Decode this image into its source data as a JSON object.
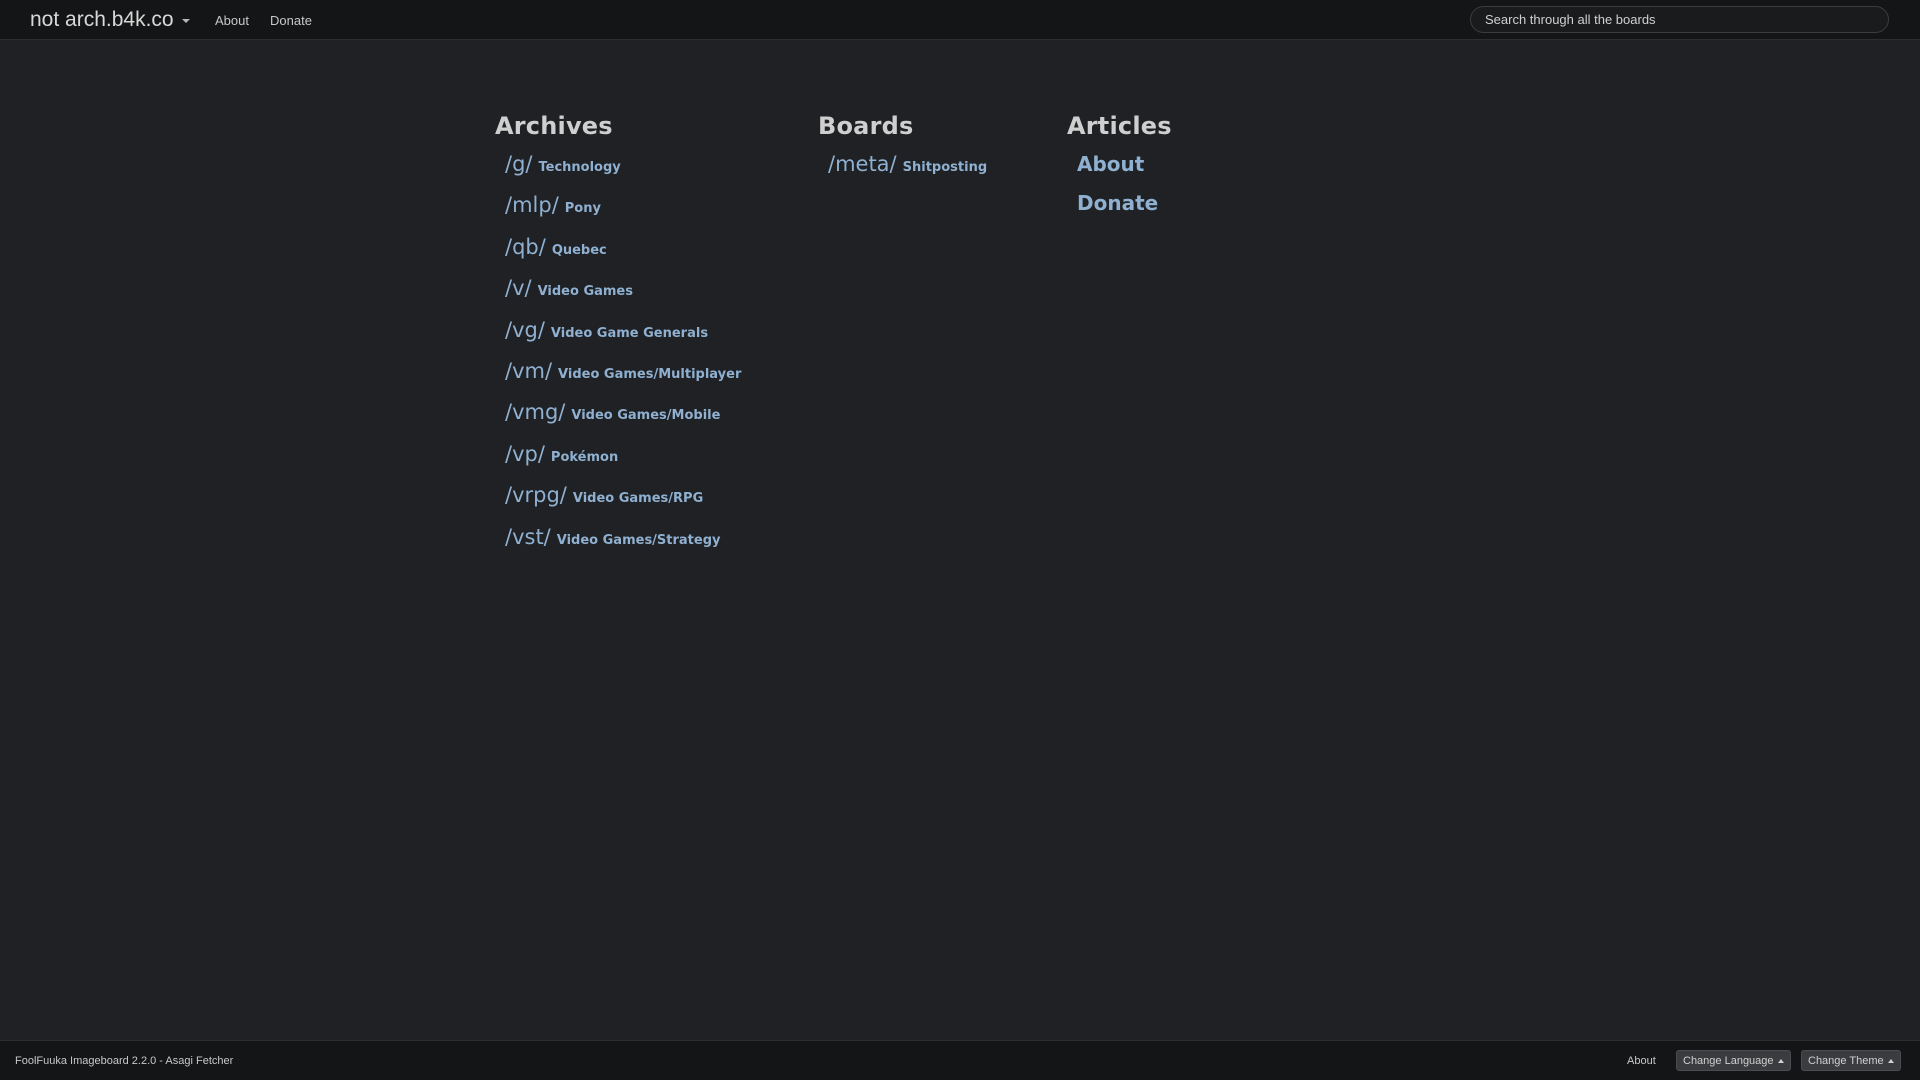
{
  "navbar": {
    "brand": "not arch.b4k.co",
    "links": [
      "About",
      "Donate"
    ],
    "search_placeholder": "Search through all the boards"
  },
  "archives": {
    "title": "Archives",
    "boards": [
      {
        "code": "/g/",
        "name": "Technology"
      },
      {
        "code": "/mlp/",
        "name": "Pony"
      },
      {
        "code": "/qb/",
        "name": "Quebec"
      },
      {
        "code": "/v/",
        "name": "Video Games"
      },
      {
        "code": "/vg/",
        "name": "Video Game Generals"
      },
      {
        "code": "/vm/",
        "name": "Video Games/Multiplayer"
      },
      {
        "code": "/vmg/",
        "name": "Video Games/Mobile"
      },
      {
        "code": "/vp/",
        "name": "Pokémon"
      },
      {
        "code": "/vrpg/",
        "name": "Video Games/RPG"
      },
      {
        "code": "/vst/",
        "name": "Video Games/Strategy"
      }
    ]
  },
  "boards": {
    "title": "Boards",
    "boards": [
      {
        "code": "/meta/",
        "name": "Shitposting"
      }
    ]
  },
  "articles": {
    "title": "Articles",
    "items": [
      "About",
      "Donate"
    ]
  },
  "footer": {
    "credit": "FoolFuuka Imageboard 2.2.0 - Asagi Fetcher",
    "about": "About",
    "change_language": "Change Language",
    "change_theme": "Change Theme"
  },
  "colors": {
    "background": "#1f2124",
    "bar": "#141517",
    "link": "#8fb0d0"
  }
}
